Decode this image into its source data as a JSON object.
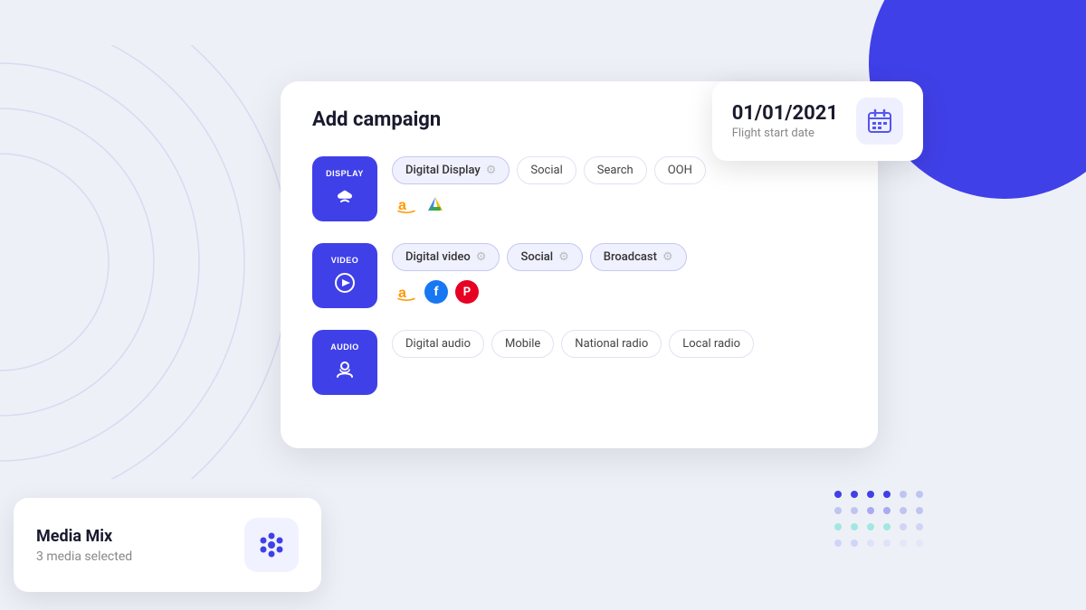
{
  "page": {
    "background_color": "#eef0f8"
  },
  "date_card": {
    "date": "01/01/2021",
    "label": "Flight start date"
  },
  "main_card": {
    "title": "Add campaign",
    "rows": [
      {
        "id": "display",
        "label": "DISPLAY",
        "tags": [
          {
            "text": "Digital Display",
            "active": true,
            "has_gear": true
          },
          {
            "text": "Social",
            "active": false,
            "has_gear": false
          },
          {
            "text": "Search",
            "active": false,
            "has_gear": false
          },
          {
            "text": "OOH",
            "active": false,
            "has_gear": false
          }
        ],
        "logos": [
          "amazon",
          "google-ads"
        ]
      },
      {
        "id": "video",
        "label": "VIDEO",
        "tags": [
          {
            "text": "Digital video",
            "active": true,
            "has_gear": true
          },
          {
            "text": "Social",
            "active": true,
            "has_gear": true
          },
          {
            "text": "Broadcast",
            "active": true,
            "has_gear": true
          }
        ],
        "logos": [
          "amazon",
          "facebook",
          "pinterest"
        ]
      },
      {
        "id": "audio",
        "label": "AUDIO",
        "tags": [
          {
            "text": "Digital audio",
            "active": false,
            "has_gear": false
          },
          {
            "text": "Mobile",
            "active": false,
            "has_gear": false
          },
          {
            "text": "National radio",
            "active": false,
            "has_gear": false
          },
          {
            "text": "Local radio",
            "active": false,
            "has_gear": false
          }
        ],
        "logos": []
      }
    ]
  },
  "media_mix": {
    "title": "Media Mix",
    "subtitle": "3 media selected"
  },
  "dots": {
    "colors": [
      "#4040e8",
      "#c0c4f0",
      "#a0e8e0",
      "#d0d4f8"
    ]
  }
}
